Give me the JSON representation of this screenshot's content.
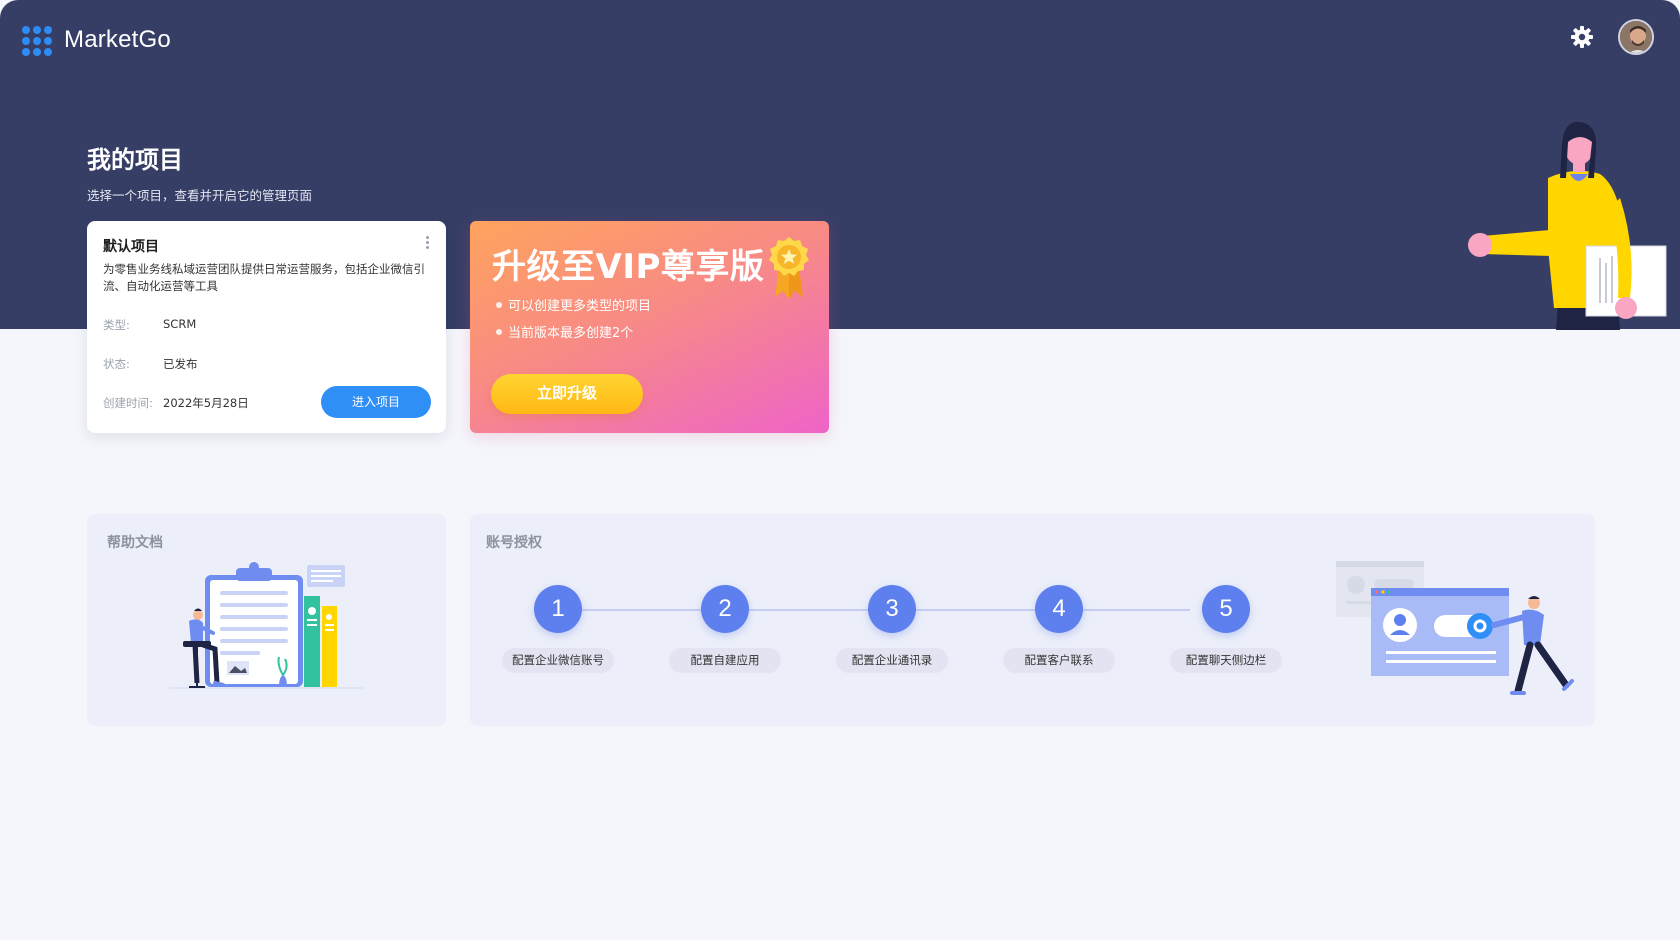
{
  "app": {
    "name": "MarketGo"
  },
  "header": {
    "settings_icon": "gear-icon",
    "avatar_icon": "user-avatar"
  },
  "hero": {
    "title": "我的项目",
    "subtitle": "选择一个项目，查看并开启它的管理页面"
  },
  "project_card": {
    "name": "默认项目",
    "description": "为零售业务线私域运营团队提供日常运营服务，包括企业微信引流、自动化运营等工具",
    "type_label": "类型:",
    "type_value": "SCRM",
    "status_label": "状态:",
    "status_value": "已发布",
    "created_label": "创建时间:",
    "created_value": "2022年5月28日",
    "enter_button": "进入项目"
  },
  "vip_card": {
    "title": "升级至VIP尊享版",
    "bullets": [
      "可以创建更多类型的项目",
      "当前版本最多创建2个"
    ],
    "upgrade_button": "立即升级"
  },
  "help_panel": {
    "title": "帮助文档"
  },
  "auth_panel": {
    "title": "账号授权",
    "steps": [
      {
        "number": "1",
        "label": "配置企业微信账号"
      },
      {
        "number": "2",
        "label": "配置自建应用"
      },
      {
        "number": "3",
        "label": "配置企业通讯录"
      },
      {
        "number": "4",
        "label": "配置客户联系"
      },
      {
        "number": "5",
        "label": "配置聊天侧边栏"
      }
    ]
  },
  "colors": {
    "header_bg": "#373e66",
    "page_bg": "#f4f6fb",
    "primary": "#2f8ff6",
    "step": "#5e7fee",
    "vip_gradient_start": "#ffa35d",
    "vip_gradient_end": "#ee64c8",
    "upgrade_button": "#ffc51f"
  }
}
